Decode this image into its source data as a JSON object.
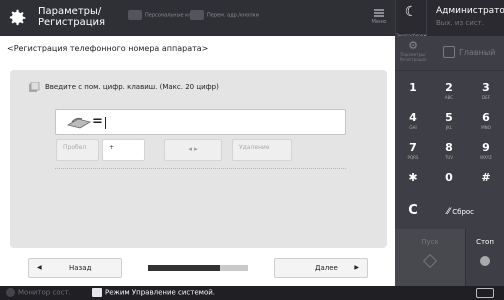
{
  "header": {
    "title_line1": "Параметры/",
    "title_line2": "Регистрация",
    "tab_personal": "Персональные кнопки",
    "tab_shared": "Перем. адр./кнопки",
    "menu_label": "Меню"
  },
  "side_header": {
    "energy_label": "Энергосбережение",
    "admin_name": "Администратор",
    "logout": "Вых. из сист."
  },
  "screen": {
    "title": "<Регистрация телефонного номера аппарата>",
    "instruction": "Введите с пом. цифр. клавиш. (Макс. 20 цифр)",
    "input_value": "",
    "pause_label": "Пробел",
    "plus_label": "+",
    "arrows_label": "◂   ▸",
    "delete_label": "Удаление"
  },
  "nav": {
    "back_label": "Назад",
    "next_label": "Далее",
    "progress": 0.72
  },
  "status": {
    "monitor_label": "Монитор сост.",
    "sys_mode": "Режим Управление системой."
  },
  "keypad": {
    "settings_mini": "Параметры/ Регистрация",
    "home_label": "Главный",
    "keys": [
      {
        "d": "1",
        "s": ""
      },
      {
        "d": "2",
        "s": "ABC"
      },
      {
        "d": "3",
        "s": "DEF"
      },
      {
        "d": "4",
        "s": "GHI"
      },
      {
        "d": "5",
        "s": "JKL"
      },
      {
        "d": "6",
        "s": "MNO"
      },
      {
        "d": "7",
        "s": "PQRS"
      },
      {
        "d": "8",
        "s": "TUV"
      },
      {
        "d": "9",
        "s": "WXYZ"
      },
      {
        "d": "✱",
        "s": ""
      },
      {
        "d": "0",
        "s": ""
      },
      {
        "d": "#",
        "s": ""
      }
    ],
    "clear_label": "C",
    "reset_label": "Сброс",
    "start_label": "Пуск",
    "stop_label": "Стоп"
  },
  "colors": {
    "dark_bg": "#3c3c44",
    "panel_bg": "#ffffff",
    "gray_area": "#e4e4e4"
  }
}
